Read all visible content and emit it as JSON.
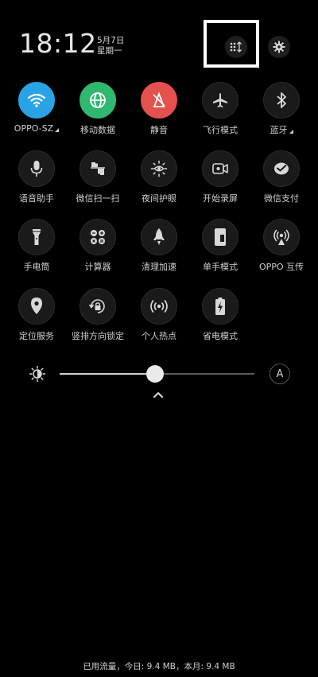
{
  "status": {
    "time": "18:12",
    "date": "5月7日",
    "weekday": "星期一"
  },
  "header": {
    "edit_icon": "grid-sort-icon",
    "settings_icon": "gear-icon"
  },
  "tiles": [
    {
      "label": "OPPO-SZ",
      "icon": "wifi-icon",
      "state": "on",
      "color": "#2aa3e6",
      "expandable": true
    },
    {
      "label": "移动数据",
      "icon": "globe-icon",
      "state": "on",
      "color": "#2fb86f"
    },
    {
      "label": "静音",
      "icon": "mute-icon",
      "state": "on",
      "color": "#e5514e"
    },
    {
      "label": "飞行模式",
      "icon": "airplane-icon",
      "state": "off"
    },
    {
      "label": "蓝牙",
      "icon": "bluetooth-icon",
      "state": "off",
      "expandable": true
    },
    {
      "label": "语音助手",
      "icon": "microphone-icon",
      "state": "off"
    },
    {
      "label": "微信扫一扫",
      "icon": "scan-icon",
      "state": "off"
    },
    {
      "label": "夜间护眼",
      "icon": "eye-sun-icon",
      "state": "off"
    },
    {
      "label": "开始录屏",
      "icon": "video-record-icon",
      "state": "off"
    },
    {
      "label": "微信支付",
      "icon": "wechat-pay-icon",
      "state": "off"
    },
    {
      "label": "手电筒",
      "icon": "flashlight-icon",
      "state": "off"
    },
    {
      "label": "计算器",
      "icon": "calculator-icon",
      "state": "off"
    },
    {
      "label": "清理加速",
      "icon": "rocket-icon",
      "state": "off"
    },
    {
      "label": "单手模式",
      "icon": "one-hand-icon",
      "state": "off"
    },
    {
      "label": "OPPO 互传",
      "icon": "share-signal-icon",
      "state": "off"
    },
    {
      "label": "定位服务",
      "icon": "location-pin-icon",
      "state": "off"
    },
    {
      "label": "竖排方向锁定",
      "icon": "rotation-lock-icon",
      "state": "off"
    },
    {
      "label": "个人热点",
      "icon": "hotspot-icon",
      "state": "off"
    },
    {
      "label": "省电模式",
      "icon": "battery-saver-icon",
      "state": "off"
    }
  ],
  "brightness": {
    "level": 0.49,
    "auto_label": "A"
  },
  "footer": {
    "data_usage": "已用流量，今日: 9.4 MB，本月: 9.4 MB"
  }
}
